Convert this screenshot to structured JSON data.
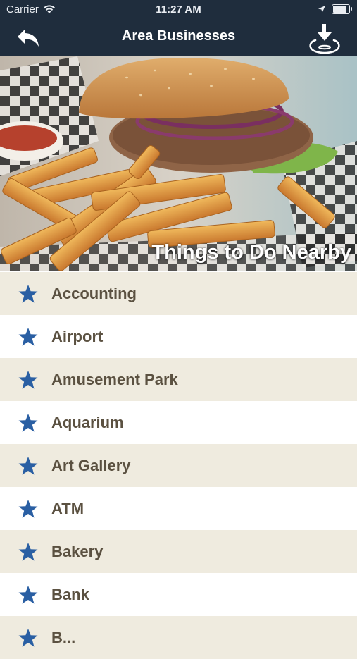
{
  "status_bar": {
    "carrier": "Carrier",
    "time": "11:27 AM"
  },
  "nav": {
    "title": "Area Businesses",
    "back_icon": "back-arrow-icon",
    "download_icon": "download-icon"
  },
  "hero": {
    "caption": "Things to Do Nearby"
  },
  "list": {
    "icon": "star-icon",
    "star_color": "#2a5fa3",
    "items": [
      {
        "label": "Accounting"
      },
      {
        "label": "Airport"
      },
      {
        "label": "Amusement Park"
      },
      {
        "label": "Aquarium"
      },
      {
        "label": "Art Gallery"
      },
      {
        "label": "ATM"
      },
      {
        "label": "Bakery"
      },
      {
        "label": "Bank"
      },
      {
        "label": "B..."
      }
    ]
  },
  "colors": {
    "nav_background": "#1f2d3d",
    "row_shaded": "#efebdf",
    "row_text": "#5b5141"
  }
}
